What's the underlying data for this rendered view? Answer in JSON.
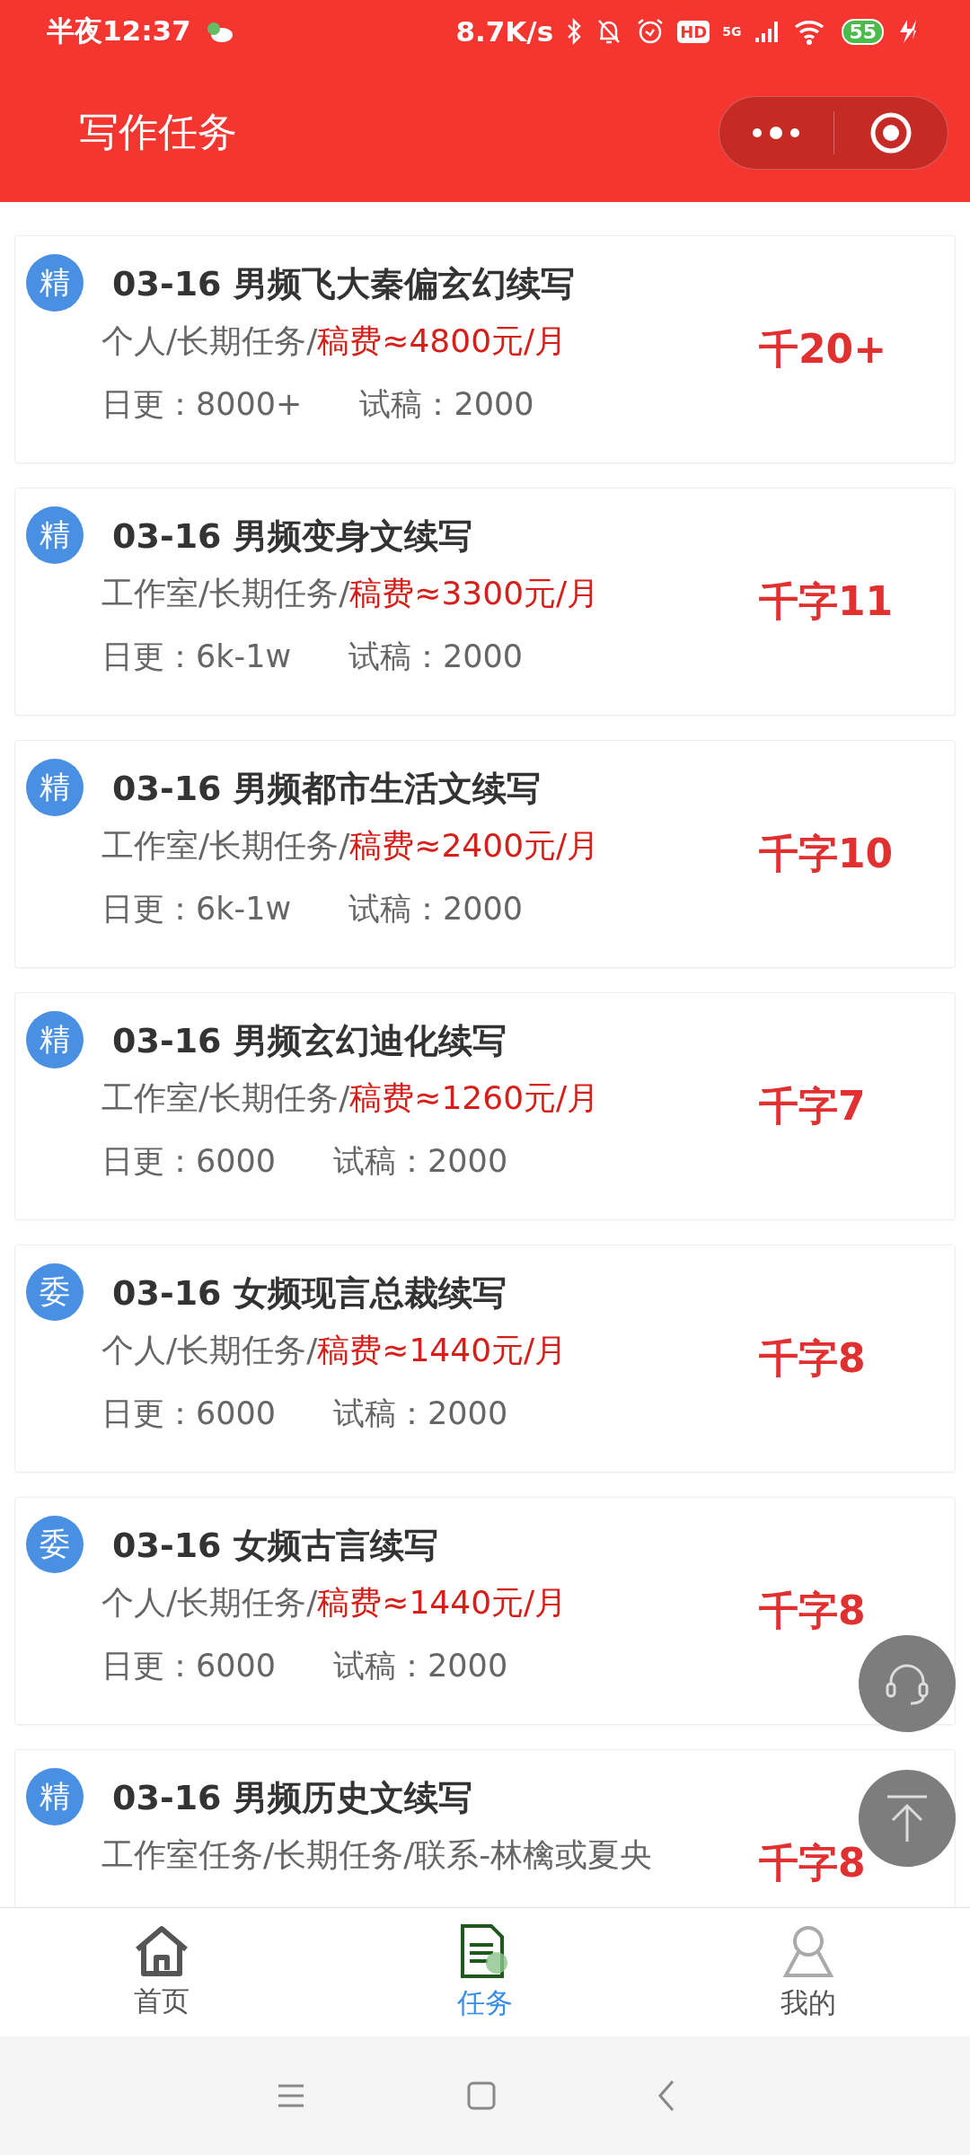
{
  "status_bar": {
    "time": "半夜12:37",
    "net_speed": "8.7K/s",
    "hd": "HD",
    "network": "5G",
    "battery": "55"
  },
  "header": {
    "title": "写作任务"
  },
  "tasks": [
    {
      "badge": "精",
      "title": "03-16 男频飞大秦偏玄幻续写",
      "type": "个人/长期任务/",
      "fee": "稿费≈4800元/月",
      "daily": "日更：8000+",
      "trial": "试稿：2000",
      "rate": "千20+"
    },
    {
      "badge": "精",
      "title": "03-16 男频变身文续写",
      "type": "工作室/长期任务/",
      "fee": "稿费≈3300元/月",
      "daily": "日更：6k-1w",
      "trial": "试稿：2000",
      "rate": "千字11"
    },
    {
      "badge": "精",
      "title": "03-16 男频都市生活文续写",
      "type": "工作室/长期任务/",
      "fee": "稿费≈2400元/月",
      "daily": "日更：6k-1w",
      "trial": "试稿：2000",
      "rate": "千字10"
    },
    {
      "badge": "精",
      "title": "03-16 男频玄幻迪化续写",
      "type": "工作室/长期任务/",
      "fee": "稿费≈1260元/月",
      "daily": "日更：6000",
      "trial": "试稿：2000",
      "rate": "千字7"
    },
    {
      "badge": "委",
      "title": "03-16 女频现言总裁续写",
      "type": "个人/长期任务/",
      "fee": "稿费≈1440元/月",
      "daily": "日更：6000",
      "trial": "试稿：2000",
      "rate": "千字8"
    },
    {
      "badge": "委",
      "title": "03-16 女频古言续写",
      "type": "个人/长期任务/",
      "fee": "稿费≈1440元/月",
      "daily": "日更：6000",
      "trial": "试稿：2000",
      "rate": "千字8"
    },
    {
      "badge": "精",
      "title": "03-16 男频历史文续写",
      "type": "工作室任务/长期任务/联系-林檎或夏央",
      "rate": "千字8"
    }
  ],
  "tabs": [
    {
      "label": "首页",
      "selected": false
    },
    {
      "label": "任务",
      "selected": true
    },
    {
      "label": "我的",
      "selected": false
    }
  ]
}
